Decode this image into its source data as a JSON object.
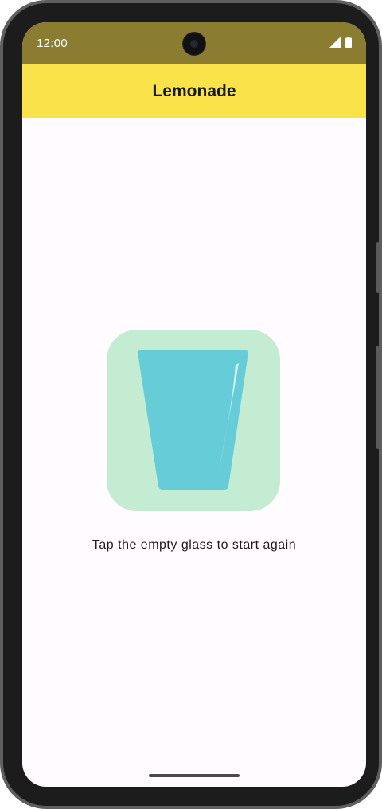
{
  "status_bar": {
    "time": "12:00",
    "icons": [
      "signal-icon",
      "battery-icon"
    ],
    "background_color": "#8a7d32"
  },
  "app_bar": {
    "title": "Lemonade",
    "background_color": "#f9e24a"
  },
  "main": {
    "image_description_icon": "empty-glass-icon",
    "instruction": "Tap the empty glass to start again",
    "tile_color": "#c3ecd3",
    "glass_color": "#66cdd8"
  }
}
